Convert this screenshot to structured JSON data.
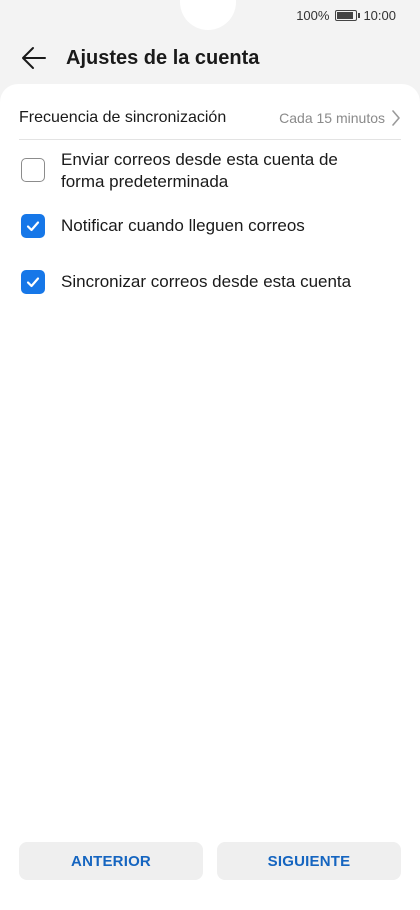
{
  "status_bar": {
    "battery_text": "100%",
    "battery_level": 1.0,
    "time": "10:00"
  },
  "app_bar": {
    "title": "Ajustes de la cuenta",
    "back_icon": "arrow-left-icon"
  },
  "sync_frequency": {
    "label": "Frecuencia de sincronización",
    "value": "Cada 15 minutos",
    "icon": "chevron-right-icon"
  },
  "options": [
    {
      "label": "Enviar correos desde esta cuenta de forma predeterminada",
      "checked": false
    },
    {
      "label": "Notificar cuando lleguen correos",
      "checked": true
    },
    {
      "label": "Sincronizar correos desde esta cuenta",
      "checked": true
    }
  ],
  "buttons": {
    "previous": "ANTERIOR",
    "next": "SIGUIENTE"
  },
  "colors": {
    "accent": "#1677e8",
    "button_text": "#1565c0",
    "background": "#f3f3f3"
  }
}
